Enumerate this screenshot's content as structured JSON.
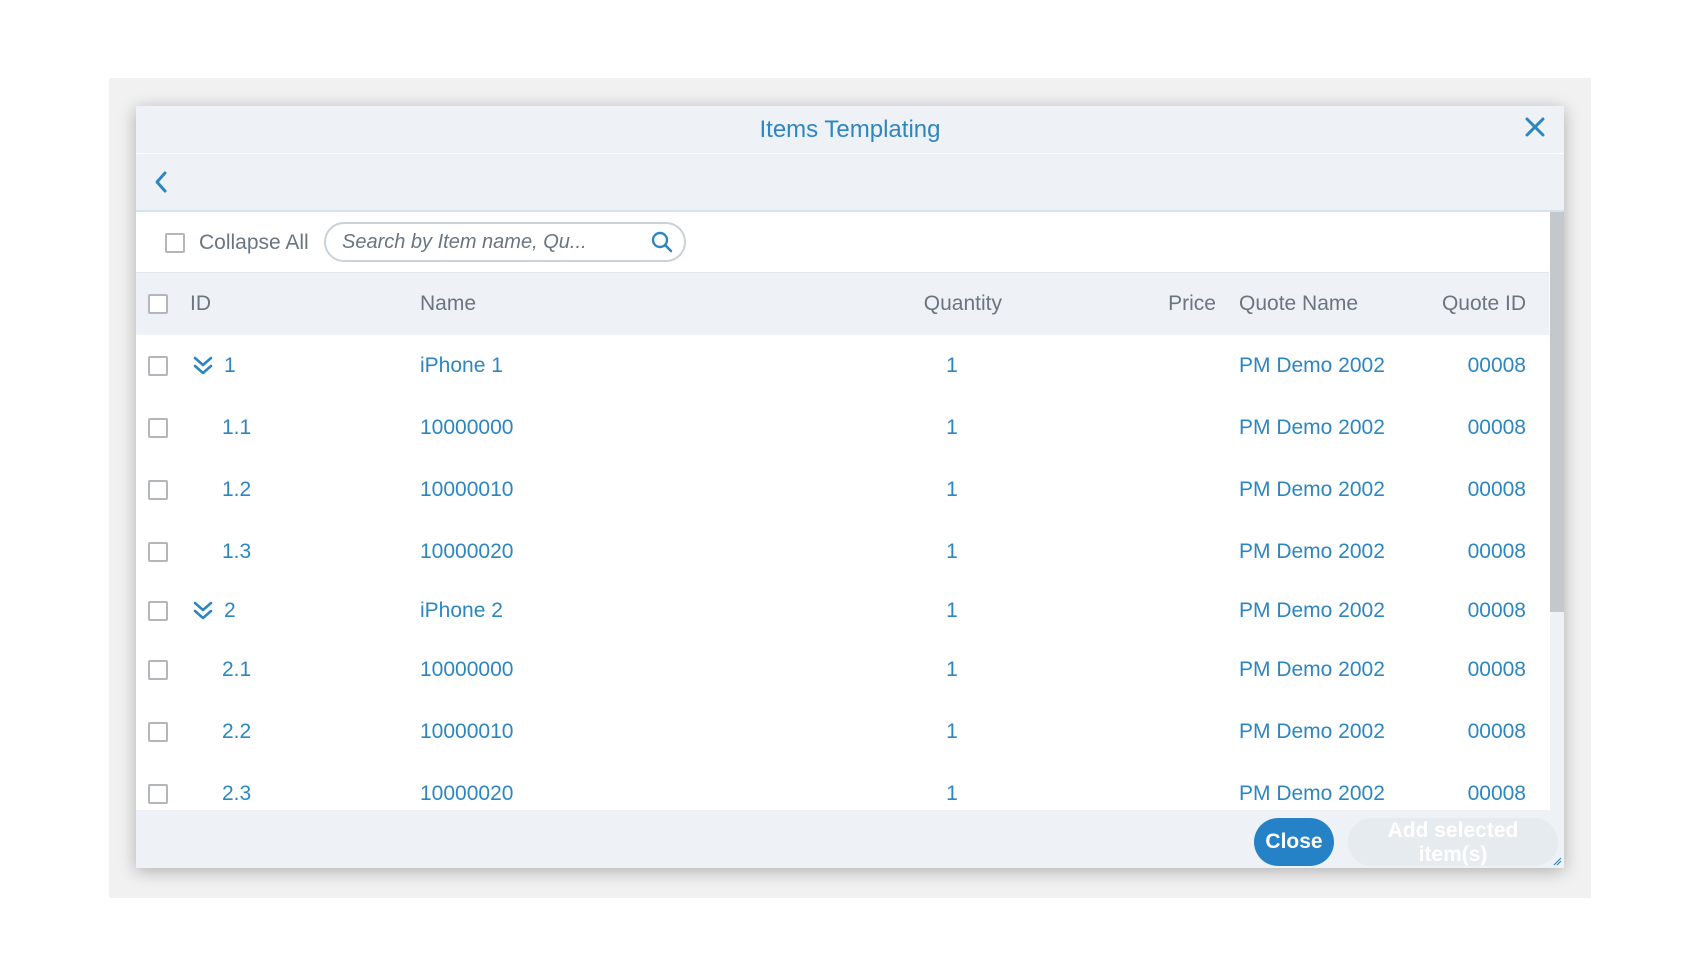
{
  "dialog": {
    "title": "Items Templating",
    "close_icon": "close-icon",
    "back_icon": "chevron-left-icon"
  },
  "toolbar": {
    "collapse_label": "Collapse All",
    "collapse_checked": false,
    "search_placeholder": "Search by Item name, Qu...",
    "search_value": "",
    "search_icon": "search-icon"
  },
  "columns": {
    "id": "ID",
    "name": "Name",
    "quantity": "Quantity",
    "price": "Price",
    "quote_name": "Quote Name",
    "quote_id": "Quote ID"
  },
  "rows": [
    {
      "id": "1",
      "name": "iPhone 1",
      "quantity": "1",
      "price": "",
      "quote_name": "PM Demo 2002",
      "quote_id": "00008",
      "parent": true
    },
    {
      "id": "1.1",
      "name": "10000000",
      "quantity": "1",
      "price": "",
      "quote_name": "PM Demo 2002",
      "quote_id": "00008",
      "parent": false
    },
    {
      "id": "1.2",
      "name": "10000010",
      "quantity": "1",
      "price": "",
      "quote_name": "PM Demo 2002",
      "quote_id": "00008",
      "parent": false
    },
    {
      "id": "1.3",
      "name": "10000020",
      "quantity": "1",
      "price": "",
      "quote_name": "PM Demo 2002",
      "quote_id": "00008",
      "parent": false
    },
    {
      "id": "2",
      "name": "iPhone 2",
      "quantity": "1",
      "price": "",
      "quote_name": "PM Demo 2002",
      "quote_id": "00008",
      "parent": true
    },
    {
      "id": "2.1",
      "name": "10000000",
      "quantity": "1",
      "price": "",
      "quote_name": "PM Demo 2002",
      "quote_id": "00008",
      "parent": false
    },
    {
      "id": "2.2",
      "name": "10000010",
      "quantity": "1",
      "price": "",
      "quote_name": "PM Demo 2002",
      "quote_id": "00008",
      "parent": false
    },
    {
      "id": "2.3",
      "name": "10000020",
      "quantity": "1",
      "price": "",
      "quote_name": "PM Demo 2002",
      "quote_id": "00008",
      "parent": false
    }
  ],
  "footer": {
    "close_label": "Close",
    "add_label": "Add selected item(s)"
  },
  "colors": {
    "accent": "#2e86c1",
    "header_bg": "#eef1f5",
    "primary_button": "#2582c6",
    "disabled_button": "#e6ebf0"
  }
}
